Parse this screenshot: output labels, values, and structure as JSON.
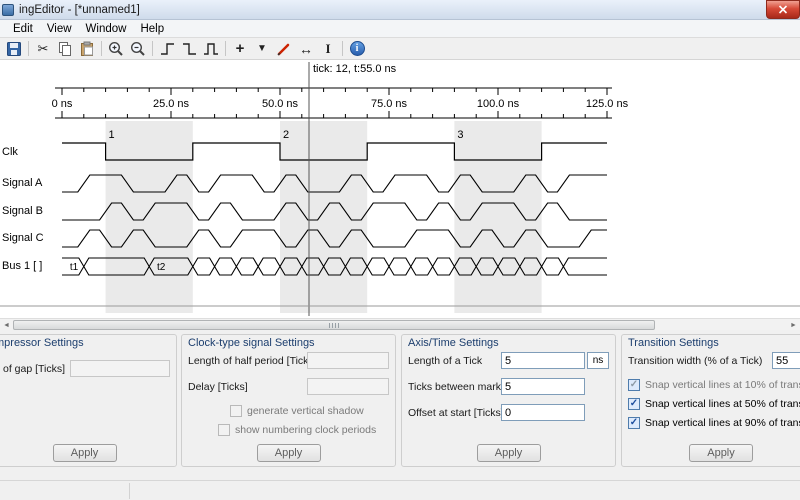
{
  "window": {
    "title": "ingEditor - [*unnamed1]"
  },
  "menu": {
    "items": [
      "Edit",
      "View",
      "Window",
      "Help"
    ]
  },
  "toolbar": {
    "glyphs": {
      "cut": "✂",
      "add": "+",
      "marker": "▼",
      "resize": "↔",
      "text": "I",
      "info": "i"
    }
  },
  "diagram": {
    "cursor_label": "tick: 12, t:55.0 ns",
    "axis_labels": [
      "0 ns",
      "25.0 ns",
      "50.0 ns",
      "75.0 ns",
      "100.0 ns",
      "125.0 ns"
    ],
    "signals": [
      {
        "name": "Clk",
        "type": "clock",
        "initial": 1,
        "edges": [
          2,
          6,
          10,
          14,
          18,
          22
        ],
        "numbers": [
          "1",
          "2",
          "3"
        ]
      },
      {
        "name": "Signal A",
        "type": "signal",
        "bits": "0110010110100101101001011"
      },
      {
        "name": "Signal B",
        "type": "signal",
        "bits": "0010110100101011010110100"
      },
      {
        "name": "Signal C",
        "type": "signal",
        "bits": "0101001011010100110101001"
      },
      {
        "name": "Bus 1 [ ]",
        "type": "bus",
        "crossings": [
          1,
          4,
          6,
          7,
          8,
          9,
          10,
          11,
          12,
          13,
          14,
          15,
          16,
          17,
          18,
          19,
          20,
          21,
          22,
          23
        ],
        "labels": [
          {
            "text": "t1",
            "tick": 0
          },
          {
            "text": "t2",
            "tick": 4
          }
        ]
      }
    ]
  },
  "panels": {
    "compressor": {
      "title": "mpressor Settings",
      "gap_label": "of gap [Ticks]",
      "gap_value": "",
      "apply": "Apply"
    },
    "clock": {
      "title": "Clock-type signal Settings",
      "half_period_label": "Length of half period [Ticks]",
      "half_period_value": "",
      "delay_label": "Delay [Ticks]",
      "delay_value": "",
      "cb_shadow": "generate vertical shadow",
      "cb_numbering": "show numbering clock periods",
      "apply": "Apply"
    },
    "axis": {
      "title": "Axis/Time Settings",
      "tick_length_label": "Length of a Tick",
      "tick_length_value": "5",
      "unit": "ns",
      "ticks_markers_label": "Ticks between markers",
      "ticks_markers_value": "5",
      "offset_label": "Offset at start [Ticks]",
      "offset_value": "0",
      "apply": "Apply"
    },
    "transition": {
      "title": "Transition Settings",
      "width_label": "Transition width (% of a Tick)",
      "width_value": "55",
      "cb10": "Snap vertical lines at 10% of trans",
      "cb50": "Snap vertical lines at 50% of trans",
      "cb90": "Snap vertical lines at 90% of trans",
      "apply": "Apply"
    }
  },
  "ui": {
    "check_glyph": "✓",
    "scroll_left": "◄",
    "scroll_right": "►"
  }
}
